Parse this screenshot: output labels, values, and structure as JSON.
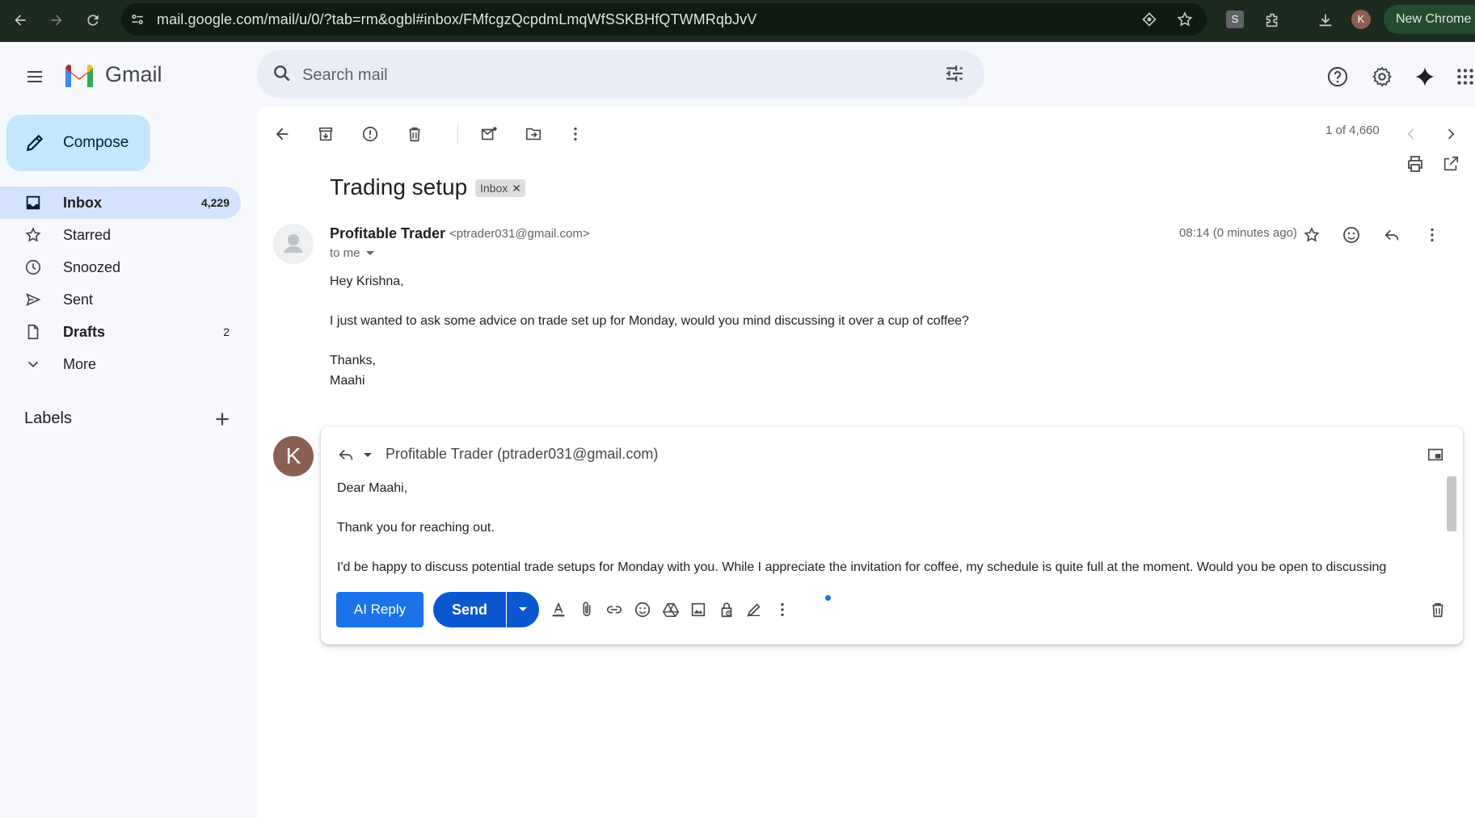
{
  "browser": {
    "url": "mail.google.com/mail/u/0/?tab=rm&ogbl#inbox/FMfcgzQcpdmLmqWfSSKBHfQTWMRqbJvV",
    "profile_initial": "K",
    "extension_letter": "S",
    "new_chrome_label": "New Chrome a"
  },
  "app": {
    "name": "Gmail",
    "search_placeholder": "Search mail"
  },
  "sidebar": {
    "compose_label": "Compose",
    "items": [
      {
        "label": "Inbox",
        "count": "4,229",
        "icon": "inbox-icon"
      },
      {
        "label": "Starred",
        "count": "",
        "icon": "star-icon"
      },
      {
        "label": "Snoozed",
        "count": "",
        "icon": "clock-icon"
      },
      {
        "label": "Sent",
        "count": "",
        "icon": "send-icon"
      },
      {
        "label": "Drafts",
        "count": "2",
        "icon": "draft-icon"
      },
      {
        "label": "More",
        "count": "",
        "icon": "chevron-down-icon"
      }
    ],
    "labels_title": "Labels"
  },
  "toolbar": {
    "pager": "1 of 4,660"
  },
  "email": {
    "subject": "Trading setup",
    "label_chip": "Inbox",
    "sender_name": "Profitable Trader",
    "sender_email": "<ptrader031@gmail.com>",
    "to": "to me",
    "timestamp": "08:14 (0 minutes ago)",
    "body": [
      "Hey Krishna,",
      "I just wanted to ask some advice on trade set up for Monday, would you mind discussing it over a cup of coffee?",
      "Thanks,",
      "Maahi"
    ]
  },
  "reply": {
    "avatar_initial": "K",
    "to": "Profitable Trader (ptrader031@gmail.com)",
    "lines": [
      "Dear Maahi,",
      "Thank you for reaching out.",
      "I'd be happy to discuss potential trade setups for Monday with you. While I appreciate the invitation for coffee, my schedule is quite full at the moment. Would you be open to discussing"
    ],
    "ai_reply_label": "AI Reply",
    "send_label": "Send"
  },
  "colors": {
    "primary": "#0b57d0",
    "compose_bg": "#c2e7ff",
    "active_nav": "#d3e3fd",
    "chrome_bg": "#1c2a1f"
  }
}
